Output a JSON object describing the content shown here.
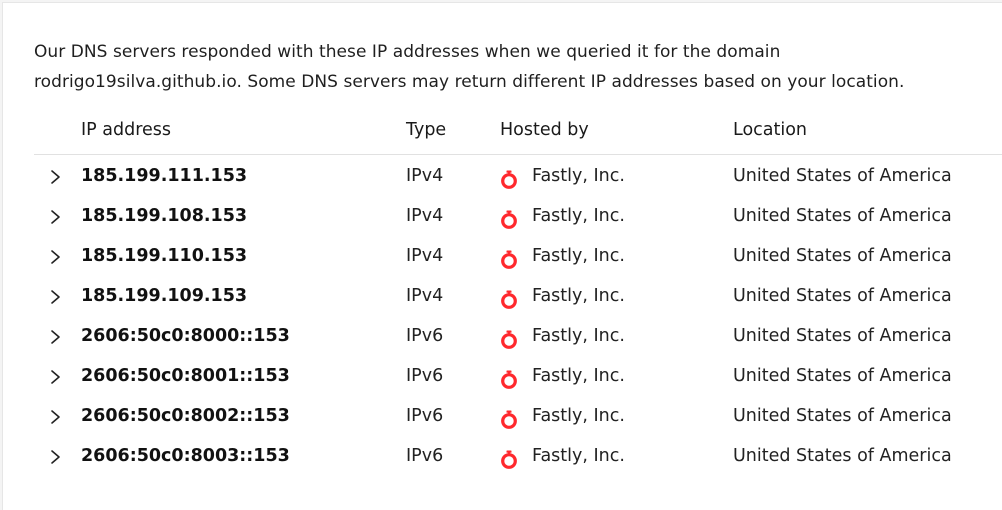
{
  "intro": {
    "line1": "Our DNS servers responded with these IP addresses when we queried it for the domain",
    "line2": "rodrigo19silva.github.io. Some DNS servers may return different IP addresses based on your location."
  },
  "table": {
    "headers": {
      "ip": "IP address",
      "type": "Type",
      "hosted_by": "Hosted by",
      "location": "Location"
    },
    "rows": [
      {
        "ip": "185.199.111.153",
        "type": "IPv4",
        "host": "Fastly, Inc.",
        "location": "United States of America"
      },
      {
        "ip": "185.199.108.153",
        "type": "IPv4",
        "host": "Fastly, Inc.",
        "location": "United States of America"
      },
      {
        "ip": "185.199.110.153",
        "type": "IPv4",
        "host": "Fastly, Inc.",
        "location": "United States of America"
      },
      {
        "ip": "185.199.109.153",
        "type": "IPv4",
        "host": "Fastly, Inc.",
        "location": "United States of America"
      },
      {
        "ip": "2606:50c0:8000::153",
        "type": "IPv6",
        "host": "Fastly, Inc.",
        "location": "United States of America"
      },
      {
        "ip": "2606:50c0:8001::153",
        "type": "IPv6",
        "host": "Fastly, Inc.",
        "location": "United States of America"
      },
      {
        "ip": "2606:50c0:8002::153",
        "type": "IPv6",
        "host": "Fastly, Inc.",
        "location": "United States of America"
      },
      {
        "ip": "2606:50c0:8003::153",
        "type": "IPv6",
        "host": "Fastly, Inc.",
        "location": "United States of America"
      }
    ]
  },
  "icons": {
    "expand": "chevron-right-icon",
    "host_logo": "fastly-logo-icon"
  },
  "colors": {
    "fastly_red": "#ff282d"
  }
}
